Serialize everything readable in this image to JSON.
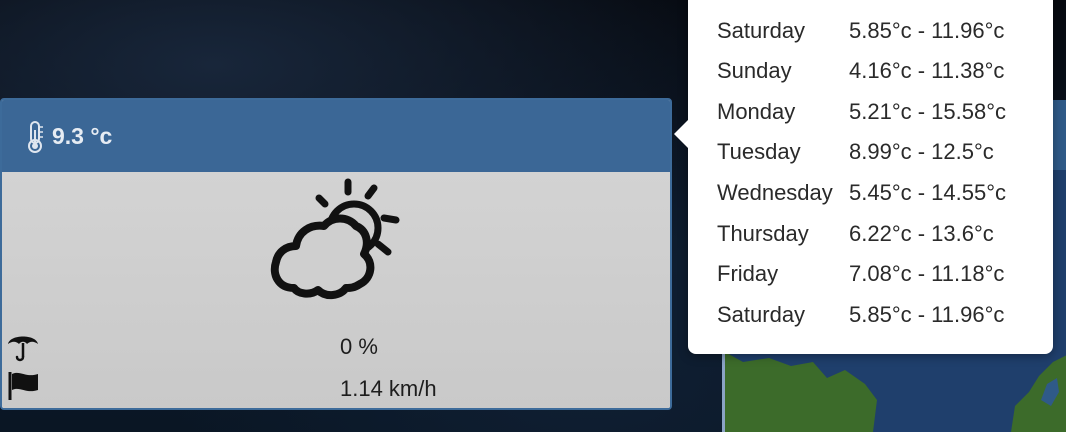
{
  "weather": {
    "current_temp": "9.3 °c",
    "precipitation": "0 %",
    "wind": "1.14 km/h",
    "icons": {
      "temperature": "thermometer-icon",
      "condition": "partly-cloudy-icon",
      "precipitation": "umbrella-icon",
      "wind": "flag-icon"
    }
  },
  "forecast": [
    {
      "day": "Saturday",
      "range": "5.85°c - 11.96°c"
    },
    {
      "day": "Sunday",
      "range": "4.16°c - 11.38°c"
    },
    {
      "day": "Monday",
      "range": "5.21°c - 15.58°c"
    },
    {
      "day": "Tuesday",
      "range": "8.99°c - 12.5°c"
    },
    {
      "day": "Wednesday",
      "range": "5.45°c - 14.55°c"
    },
    {
      "day": "Thursday",
      "range": "6.22°c - 13.6°c"
    },
    {
      "day": "Friday",
      "range": "7.08°c - 11.18°c"
    },
    {
      "day": "Saturday",
      "range": "5.85°c - 11.96°c"
    }
  ],
  "colors": {
    "header": "#3b6796",
    "card_body": "#cfcfcf",
    "popover": "#ffffff"
  }
}
